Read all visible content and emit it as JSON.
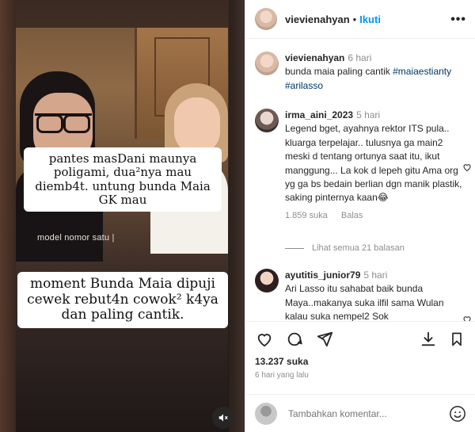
{
  "video": {
    "caption_top": "pantes masDani maunya poligami, dua²nya mau  diemb4t. untung bunda Maia GK mau",
    "watermark": "model nomor satu |",
    "caption_bottom": "moment Bunda Maia dipuji cewek rebut4n cowok² k4ya dan paling cantik.",
    "mute_icon": "speaker-muted-icon"
  },
  "header": {
    "username": "vievienahyan",
    "separator": "•",
    "follow_label": "Ikuti",
    "more_icon": "•••"
  },
  "post": {
    "username": "vievienahyan",
    "time": "6 hari",
    "text": "bunda maia paling cantik ",
    "tag1": "#maiaestianty",
    "tag2": "#arilasso"
  },
  "comments": [
    {
      "username": "irma_aini_2023",
      "time": "5 hari",
      "text": "Legend bget, ayahnya rektor ITS pula.. kluarga terpelajar.. tulusnya ga main2 meski d tentang ortunya saat itu, ikut manggung... La kok d lepeh gitu Ama org yg ga bs bedain berlian dgn manik plastik, saking pinternya kaan😂",
      "likes": "1.859 suka",
      "reply_label": "Balas",
      "view_replies": "Lihat semua 21 balasan"
    },
    {
      "username": "ayutitis_junior79",
      "time": "5 hari",
      "text": "Ari Lasso itu sahabat baik bunda Maya..makanya suka ilfil sama Wulan kalau suka nempel2 Sok"
    }
  ],
  "actions": {
    "likes": "13.237 suka",
    "date": "6 hari yang lalu"
  },
  "add_comment": {
    "placeholder": "Tambahkan komentar..."
  }
}
